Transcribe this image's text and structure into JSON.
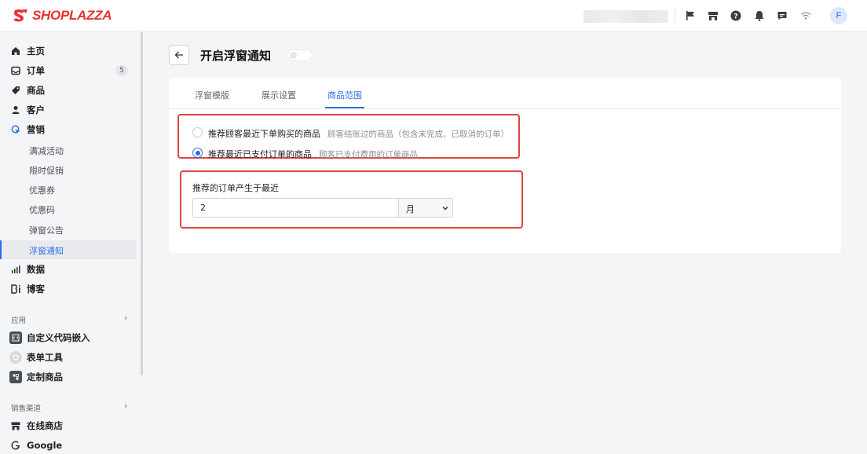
{
  "header": {
    "logo_text": "SHOPLAZZA",
    "avatar_initial": "F",
    "icons": [
      "flag-icon",
      "store-icon",
      "help-icon",
      "bell-icon",
      "message-icon",
      "wifi-icon"
    ]
  },
  "sidebar": {
    "main_items": [
      {
        "label": "主页",
        "icon": "home-icon"
      },
      {
        "label": "订单",
        "icon": "inbox-icon",
        "badge": "5"
      },
      {
        "label": "商品",
        "icon": "tag-icon"
      },
      {
        "label": "客户",
        "icon": "person-icon"
      },
      {
        "label": "营销",
        "icon": "marketing-icon"
      }
    ],
    "marketing_sub": [
      {
        "label": "满减活动"
      },
      {
        "label": "限时促销"
      },
      {
        "label": "优惠券"
      },
      {
        "label": "优惠码"
      },
      {
        "label": "弹窗公告"
      },
      {
        "label": "浮窗通知",
        "active": true
      }
    ],
    "more_items": [
      {
        "label": "数据",
        "icon": "bar-chart-icon"
      },
      {
        "label": "博客",
        "icon": "blog-icon"
      }
    ],
    "apps_section": "应用",
    "apps": [
      {
        "label": "自定义代码嵌入",
        "icon": "code-embed-icon"
      },
      {
        "label": "表单工具",
        "icon": "form-tool-icon"
      },
      {
        "label": "定制商品",
        "icon": "custom-product-icon"
      }
    ],
    "channels_section": "销售渠道",
    "channels": [
      {
        "label": "在线商店",
        "icon": "store-icon"
      },
      {
        "label": "Google",
        "icon": "google-icon"
      }
    ]
  },
  "page": {
    "title": "开启浮窗通知",
    "toggle_on": false,
    "tabs": [
      {
        "label": "浮窗模版"
      },
      {
        "label": "展示设置"
      },
      {
        "label": "商品范围",
        "active": true
      }
    ],
    "options": [
      {
        "label": "推荐顾客最近下单购买的商品",
        "desc": "顾客结账过的商品（包含未完成、已取消的订单）",
        "checked": false
      },
      {
        "label": "推荐最近已支付订单的商品",
        "desc": "顾客已支付费用的订单商品",
        "checked": true
      }
    ],
    "period_label": "推荐的订单产生于最近",
    "period_value": "2",
    "period_unit": "月"
  },
  "colors": {
    "accent": "#2f6fe4",
    "brand": "#e8312f",
    "highlight": "#e0443e"
  }
}
